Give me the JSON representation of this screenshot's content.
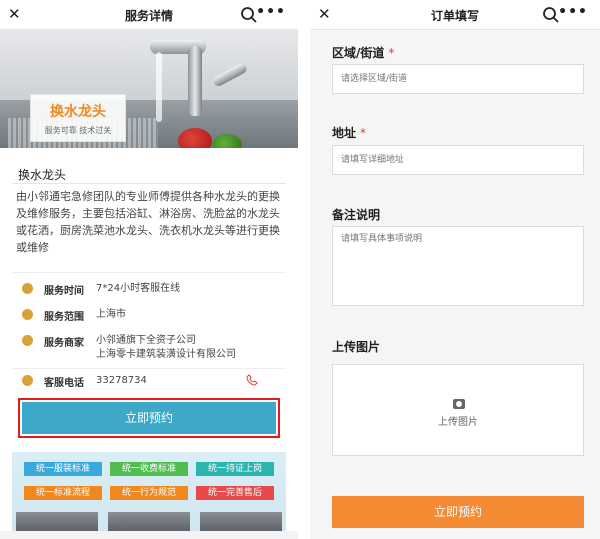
{
  "left": {
    "header": {
      "title": "服务详情"
    },
    "banner": {
      "title": "换水龙头",
      "subtitle": "服务可靠 技术过关"
    },
    "service": {
      "name": "换水龙头",
      "description": "由小邻通宅急修团队的专业师傅提供各种水龙头的更换及维修服务，主要包括浴缸、淋浴房、洗脸盆的水龙头或花洒，厨房洗菜池水龙头、洗衣机水龙头等进行更换或维修"
    },
    "info": {
      "hours_label": "服务时间",
      "hours_value": "7*24小时客服在线",
      "area_label": "服务范围",
      "area_value": "上海市",
      "merchant_label": "服务商家",
      "merchant_line1": "小邻通旗下全资子公司",
      "merchant_line2": "上海零卡建筑装潢设计有限公司",
      "phone_label": "客服电话",
      "phone_value": "33278734"
    },
    "book_button": "立即预约",
    "promo_tags": [
      "统一服装标准",
      "统一收费标准",
      "统一持证上岗",
      "统一标准流程",
      "统一行为规范",
      "统一完善售后"
    ]
  },
  "right": {
    "header": {
      "title": "订单填写"
    },
    "fields": {
      "region_label": "区域/街道",
      "region_placeholder": "请选择区域/街道",
      "address_label": "地址",
      "address_placeholder": "请填写详细地址",
      "notes_label": "备注说明",
      "notes_placeholder": "请填写具体事项说明",
      "upload_label": "上传图片",
      "upload_text": "上传图片",
      "required_mark": "*"
    },
    "submit_button": "立即预约"
  },
  "colors": {
    "book_button": "#3ea8c9",
    "submit_button": "#f48a34",
    "highlight_frame": "#e21b1b",
    "banner_title": "#f08a1e"
  }
}
